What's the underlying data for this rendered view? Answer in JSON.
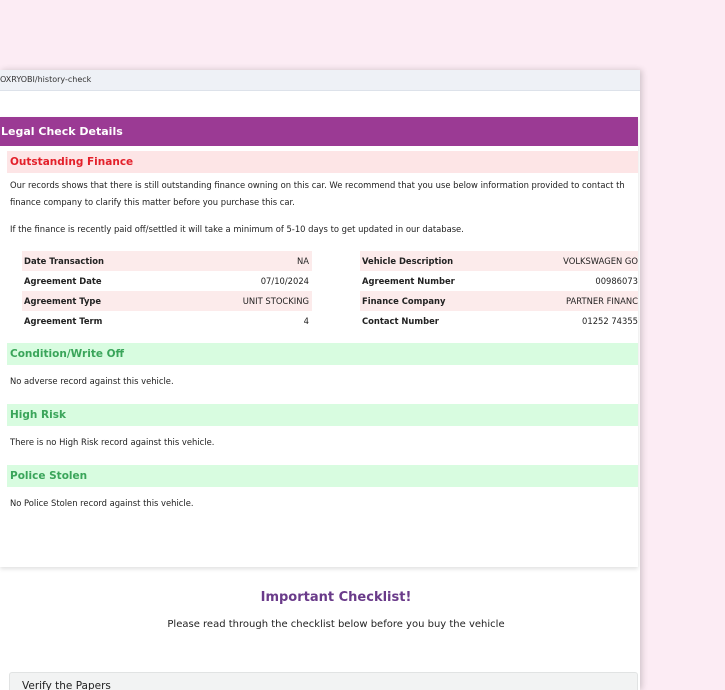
{
  "browser": {
    "url": "OXRYOBI/history-check"
  },
  "card": {
    "title": "Legal Check Details",
    "outstanding_finance": {
      "heading": "Outstanding Finance",
      "text_line1": "Our records shows that there is still outstanding finance owning on this car. We recommend that you use below information provided to contact th",
      "text_line2": "finance company to clarify this matter before you purchase this car.",
      "text_line3": "If the finance is recently paid off/settled it will take a minimum of 5-10 days to get updated in our database.",
      "left_table": [
        {
          "label": "Date Transaction",
          "value": "NA"
        },
        {
          "label": "Agreement Date",
          "value": "07/10/2024"
        },
        {
          "label": "Agreement Type",
          "value": "UNIT STOCKING"
        },
        {
          "label": "Agreement Term",
          "value": "4"
        }
      ],
      "right_table": [
        {
          "label": "Vehicle Description",
          "value": "VOLKSWAGEN GO"
        },
        {
          "label": "Agreement Number",
          "value": "00986073"
        },
        {
          "label": "Finance Company",
          "value": "PARTNER FINANC"
        },
        {
          "label": "Contact Number",
          "value": "01252 74355"
        }
      ]
    },
    "condition": {
      "heading": "Condition/Write Off",
      "text": "No adverse record against this vehicle."
    },
    "high_risk": {
      "heading": "High Risk",
      "text": "There is no High Risk record against this vehicle."
    },
    "police_stolen": {
      "heading": "Police Stolen",
      "text": "No Police Stolen record against this vehicle."
    }
  },
  "checklist": {
    "title": "Important Checklist!",
    "subtitle": "Please read through the checklist below before you buy the vehicle",
    "verify_papers": "Verify the Papers"
  },
  "colors": {
    "background": "#fcecf4",
    "header_purple": "#9b3a94",
    "finance_band": "#fde5e6",
    "finance_text": "#e3202a",
    "ok_band": "#d8fce0",
    "ok_text": "#3aa55a",
    "checklist_title": "#6a3b8a"
  }
}
